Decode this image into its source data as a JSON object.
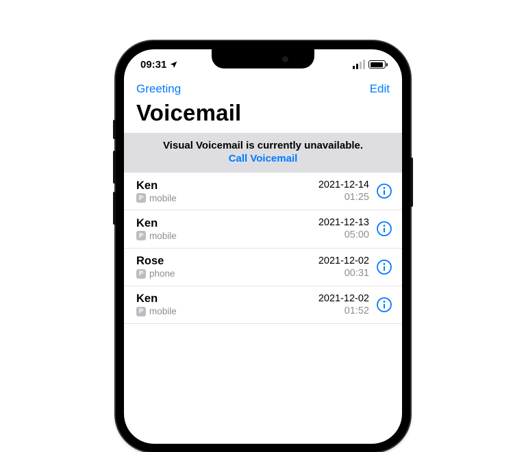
{
  "status": {
    "time": "09:31",
    "location_icon": "location-arrow"
  },
  "nav": {
    "left": "Greeting",
    "right": "Edit"
  },
  "title": "Voicemail",
  "banner": {
    "message": "Visual Voicemail is currently unavailable.",
    "action": "Call Voicemail"
  },
  "badge_letter": "P",
  "voicemails": [
    {
      "name": "Ken",
      "label": "mobile",
      "date": "2021-12-14",
      "duration": "01:25"
    },
    {
      "name": "Ken",
      "label": "mobile",
      "date": "2021-12-13",
      "duration": "05:00"
    },
    {
      "name": "Rose",
      "label": "phone",
      "date": "2021-12-02",
      "duration": "00:31"
    },
    {
      "name": "Ken",
      "label": "mobile",
      "date": "2021-12-02",
      "duration": "01:52"
    }
  ],
  "colors": {
    "accent": "#007aff"
  }
}
